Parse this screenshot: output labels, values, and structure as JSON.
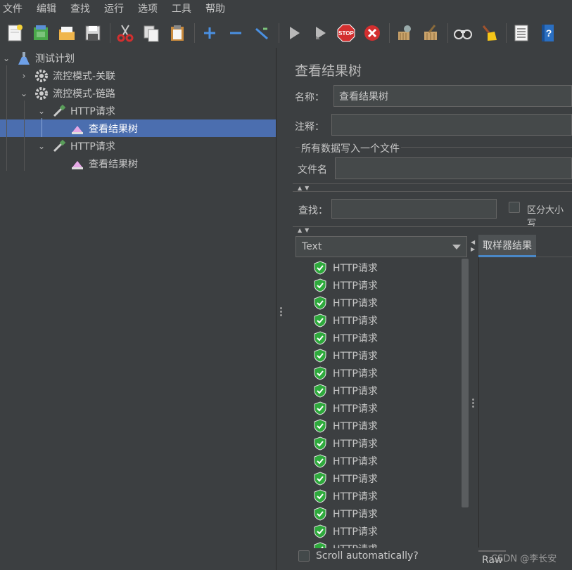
{
  "menu": [
    "文件",
    "编辑",
    "查找",
    "运行",
    "选项",
    "工具",
    "帮助"
  ],
  "toolbar_icons": [
    "new-icon",
    "templates-icon",
    "open-icon",
    "save-icon",
    "cut-icon",
    "copy-icon",
    "paste-icon",
    "expand-icon",
    "collapse-icon",
    "toggle-icon",
    "start-icon",
    "start-no-pause-icon",
    "stop-icon",
    "shutdown-icon",
    "clear-icon",
    "clear-all-icon",
    "search-icon",
    "reset-search-icon",
    "function-helper-icon",
    "help-icon"
  ],
  "tree": {
    "root": "测试计划",
    "node1": "流控模式-关联",
    "node2": "流控模式-链路",
    "http1": "HTTP请求",
    "listener1": "查看结果树",
    "http2": "HTTP请求",
    "listener2": "查看结果树"
  },
  "panel": {
    "title": "查看结果树",
    "name_label": "名称：",
    "name_value": "查看结果树",
    "comment_label": "注释：",
    "comment_value": "",
    "file_section": "所有数据写入一个文件",
    "filename_label": "文件名",
    "filename_value": "",
    "search_label": "查找：",
    "search_value": "",
    "case_sensitive": "区分大小写",
    "renderer": "Text",
    "results_tab": "取样器结果",
    "raw_tab": "Raw",
    "scroll_auto": "Scroll automatically?",
    "watermark": "CSDN @李长安"
  },
  "samples": [
    "HTTP请求",
    "HTTP请求",
    "HTTP请求",
    "HTTP请求",
    "HTTP请求",
    "HTTP请求",
    "HTTP请求",
    "HTTP请求",
    "HTTP请求",
    "HTTP请求",
    "HTTP请求",
    "HTTP请求",
    "HTTP请求",
    "HTTP请求",
    "HTTP请求",
    "HTTP请求",
    "HTTP请求"
  ],
  "colors": {
    "selection": "#4b6eaf",
    "success": "#2eaa3c",
    "background": "#3c3f41"
  }
}
